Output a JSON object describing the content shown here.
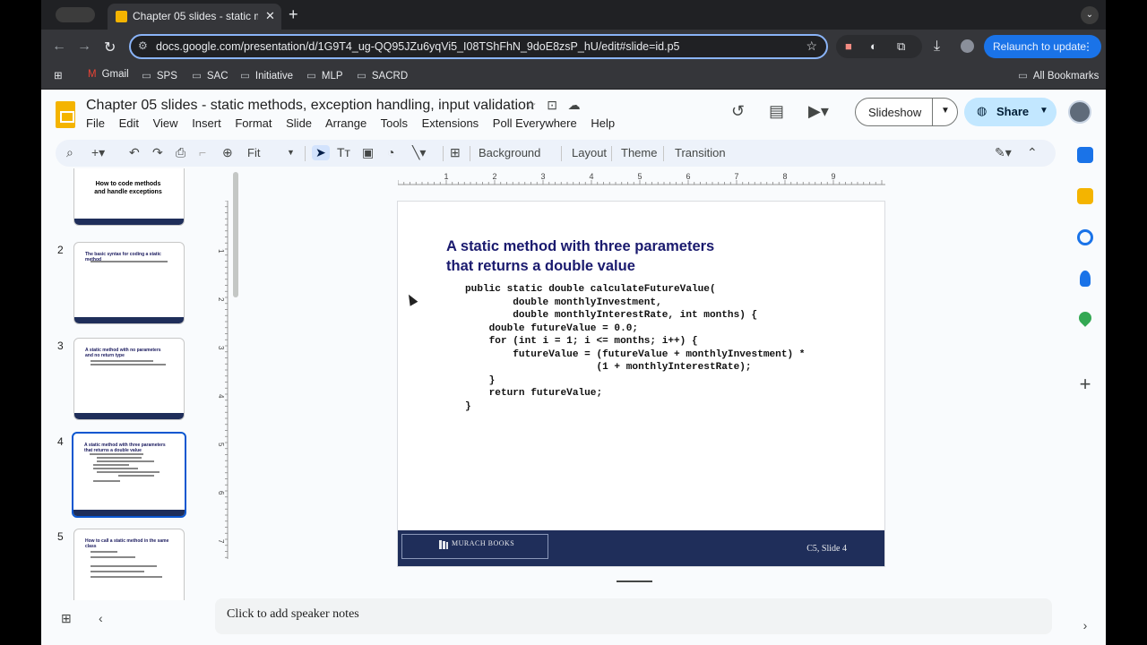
{
  "browser": {
    "tab_title": "Chapter 05 slides - static me",
    "tab_close": "✕",
    "new_tab": "+",
    "url": "docs.google.com/presentation/d/1G9T4_ug-QQ95JZu6yqVi5_I08TShFhN_9doE8zsP_hU/edit#slide=id.p5",
    "relaunch_label": "Relaunch to update",
    "bookmarks": [
      "Gmail",
      "SPS",
      "SAC",
      "Initiative",
      "MLP",
      "SACRD"
    ],
    "all_bookmarks": "All Bookmarks"
  },
  "app": {
    "doc_title": "Chapter 05 slides - static methods, exception handling, input validation",
    "menu": [
      "File",
      "Edit",
      "View",
      "Insert",
      "Format",
      "Slide",
      "Arrange",
      "Tools",
      "Extensions",
      "Poll Everywhere",
      "Help"
    ],
    "slideshow_label": "Slideshow",
    "share_label": "Share",
    "toolbar": {
      "zoom": "Fit",
      "background": "Background",
      "layout": "Layout",
      "theme": "Theme",
      "transition": "Transition"
    },
    "speaker_notes_placeholder": "Click to add speaker notes"
  },
  "filmstrip": [
    {
      "number": "",
      "title": "How to code methods\nand handle exceptions"
    },
    {
      "number": "2",
      "title": "The basic syntax for coding a static method"
    },
    {
      "number": "3",
      "title": "A static method with no parameters\nand no return type"
    },
    {
      "number": "4",
      "title": "A static method with three parameters\nthat returns a double value"
    },
    {
      "number": "5",
      "title": "How to call a static method in the same class"
    }
  ],
  "ruler": {
    "horizontal": [
      "1",
      "2",
      "3",
      "4",
      "5",
      "6",
      "7",
      "8",
      "9"
    ],
    "vertical": [
      "1",
      "2",
      "3",
      "4",
      "5",
      "6",
      "7"
    ]
  },
  "slide": {
    "heading_line1": "A static method with three parameters",
    "heading_line2": "that returns a double value",
    "code": "public static double calculateFutureValue(\n        double monthlyInvestment,\n        double monthlyInterestRate, int months) {\n    double futureValue = 0.0;\n    for (int i = 1; i <= months; i++) {\n        futureValue = (futureValue + monthlyInvestment) *\n                      (1 + monthlyInterestRate);\n    }\n    return futureValue;\n}",
    "footer_brand": "MURACH BOOKS",
    "footer_slide": "C5, Slide 4"
  }
}
